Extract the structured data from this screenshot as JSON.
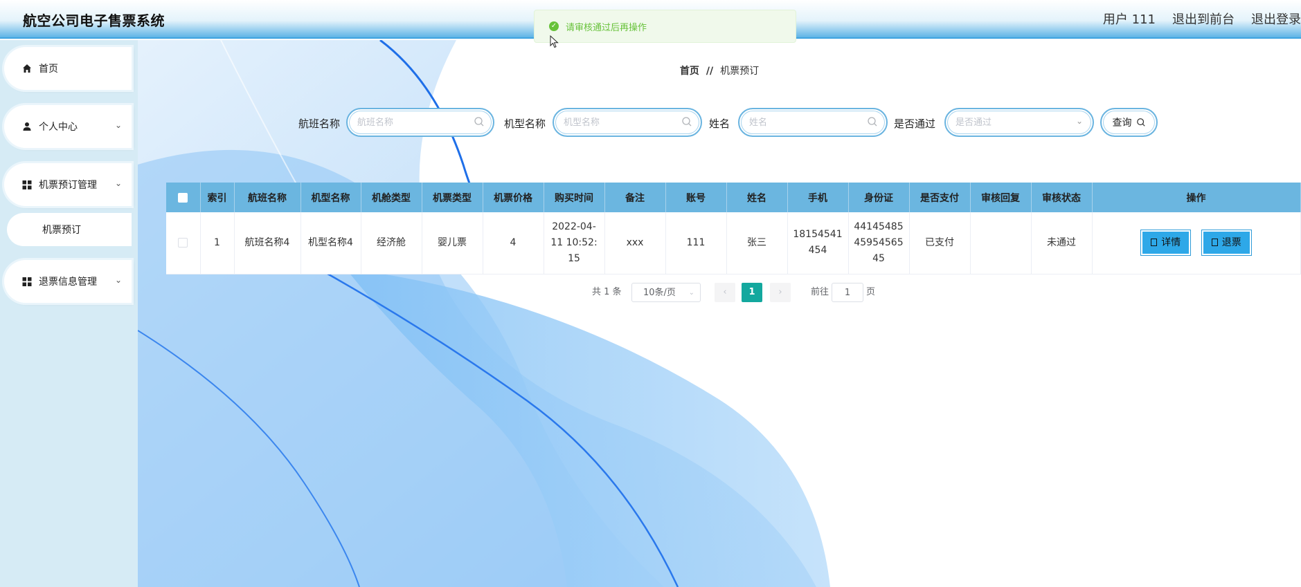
{
  "app": {
    "title": "航空公司电子售票系统"
  },
  "header": {
    "user": "用户 111",
    "to_front": "退出到前台",
    "logout": "退出登录"
  },
  "toast": {
    "message": "请审核通过后再操作"
  },
  "sidebar": {
    "home": "首页",
    "personal": "个人中心",
    "booking_mgmt": "机票预订管理",
    "booking": "机票预订",
    "refund_mgmt": "退票信息管理"
  },
  "breadcrumb": {
    "home": "首页",
    "separator": "//",
    "current": "机票预订"
  },
  "search": {
    "flight_label": "航班名称",
    "flight_placeholder": "航班名称",
    "model_label": "机型名称",
    "model_placeholder": "机型名称",
    "name_label": "姓名",
    "name_placeholder": "姓名",
    "passed_label": "是否通过",
    "passed_placeholder": "是否通过",
    "query_button": "查询"
  },
  "table": {
    "headers": [
      "索引",
      "航班名称",
      "机型名称",
      "机舱类型",
      "机票类型",
      "机票价格",
      "购买时间",
      "备注",
      "账号",
      "姓名",
      "手机",
      "身份证",
      "是否支付",
      "审核回复",
      "审核状态",
      "操作"
    ],
    "rows": [
      {
        "index": "1",
        "flight": "航班名称4",
        "model": "机型名称4",
        "cabin": "经济舱",
        "ticket_type": "婴儿票",
        "price": "4",
        "time_1": "2022-04-",
        "time_2": "11 10:52:",
        "time_3": "15",
        "remark": "xxx",
        "account": "111",
        "name": "张三",
        "phone_1": "18154541",
        "phone_2": "454",
        "id_1": "44145485",
        "id_2": "45954565",
        "id_3": "45",
        "paid": "已支付",
        "reply": "",
        "status": "未通过",
        "detail_button": "详情",
        "refund_button": "退票"
      }
    ]
  },
  "pagination": {
    "total": "共 1 条",
    "page_size": "10条/页",
    "current_page": "1",
    "goto_prefix": "前往",
    "goto_value": "1",
    "goto_suffix": "页"
  },
  "colors": {
    "header_blue": "#5fb4e6",
    "table_header": "#6bb6e0",
    "action_button": "#2ea8e8",
    "active_page": "#13a89e",
    "toast_text": "#67c23a"
  }
}
